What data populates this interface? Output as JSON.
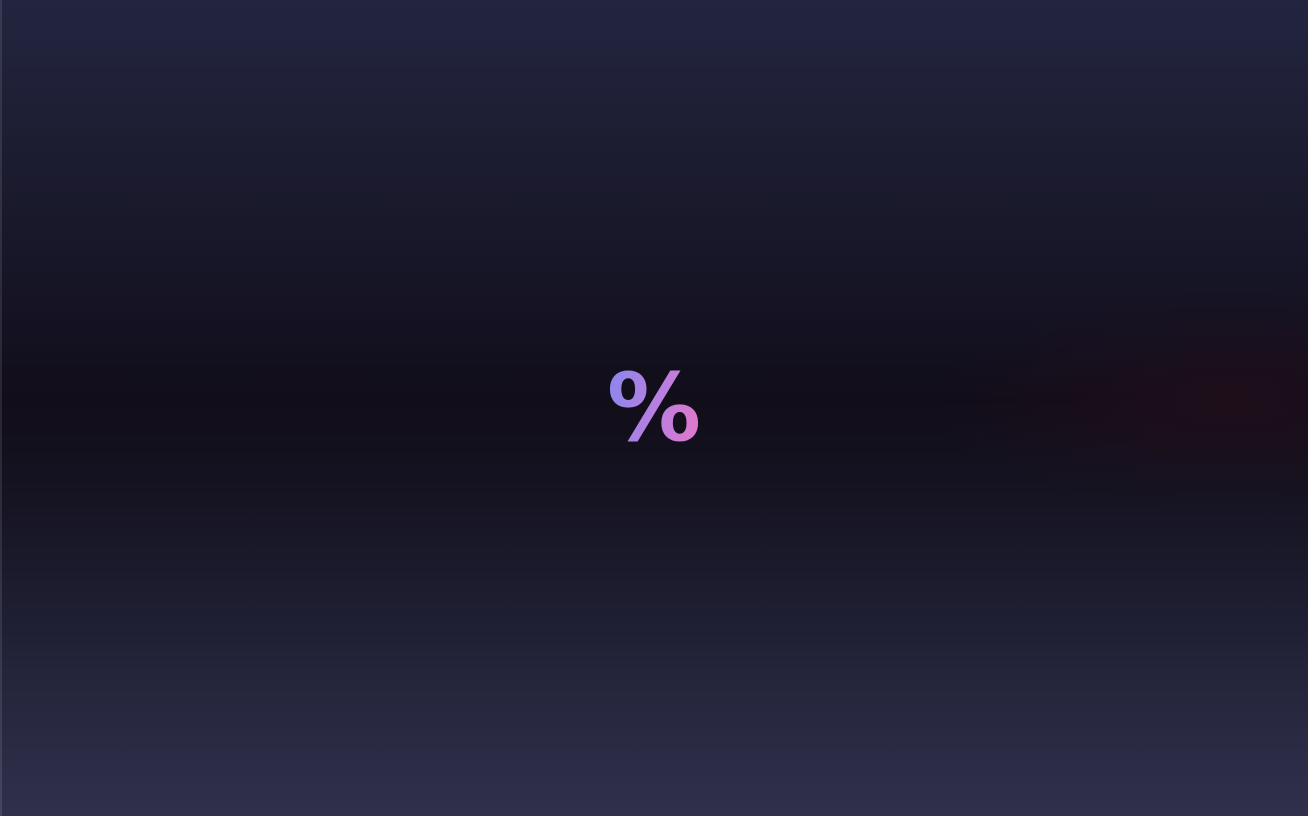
{
  "loading_screen": {
    "glyph": "%",
    "glyph_icon": "percent-icon",
    "colors": {
      "gradient_start": "#8388ef",
      "gradient_mid": "#b77fe0",
      "gradient_end": "#ee76c4",
      "background_top": "#232540",
      "background_middle": "#110d19",
      "background_bottom": "#30304d"
    }
  }
}
